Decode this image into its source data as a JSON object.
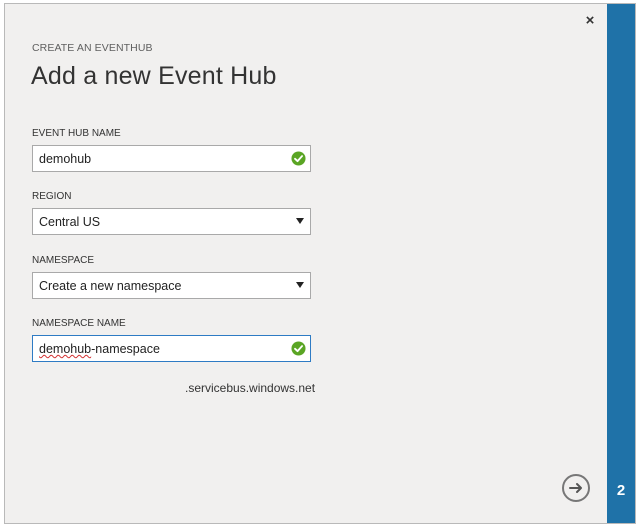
{
  "dialog": {
    "subtitle": "CREATE AN EVENTHUB",
    "title": "Add a new Event Hub",
    "close_glyph": "×",
    "step_number": "2"
  },
  "fields": {
    "event_hub_name": {
      "label": "EVENT HUB NAME",
      "value": "demohub",
      "valid": true
    },
    "region": {
      "label": "REGION",
      "selected": "Central US"
    },
    "namespace": {
      "label": "NAMESPACE",
      "selected": "Create a new namespace"
    },
    "namespace_name": {
      "label": "NAMESPACE NAME",
      "value_part1": "demohub",
      "value_part2": "-namespace",
      "valid": true,
      "suffix": ".servicebus.windows.net"
    }
  },
  "icons": {
    "valid": "check-circle-icon",
    "next": "arrow-right-circle-icon",
    "close": "close-icon",
    "dropdown": "chevron-down-icon"
  },
  "colors": {
    "accent": "#1f72a8",
    "valid_green": "#5aa524",
    "focus_border": "#2e7bc4",
    "dialog_bg": "#f1f0ef"
  }
}
